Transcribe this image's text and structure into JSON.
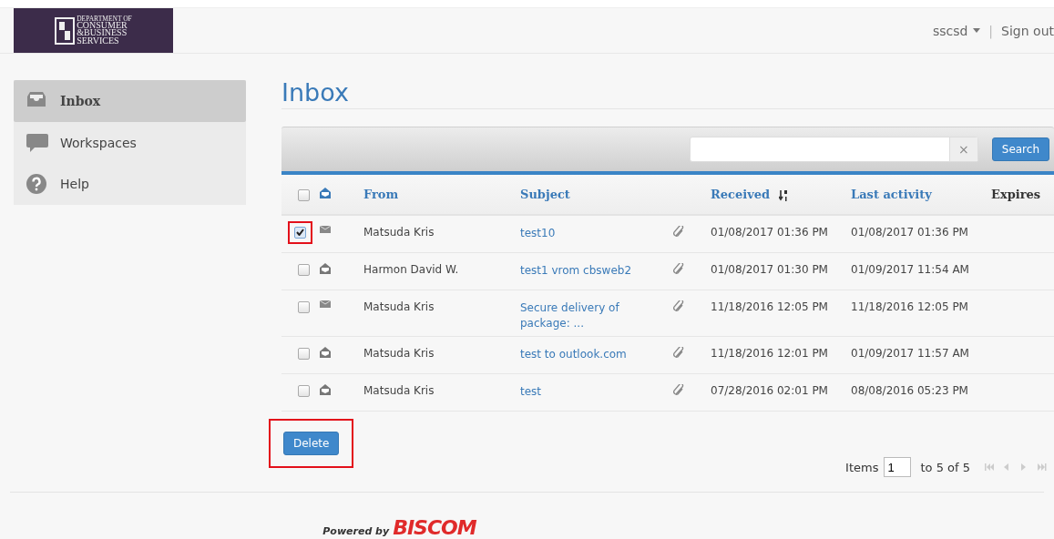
{
  "header": {
    "logo_lines": [
      "DEPARTMENT OF",
      "CONSUMER",
      "&BUSINESS",
      "SERVICES"
    ],
    "user": "sscsd",
    "separator": "|",
    "sign_out": "Sign out"
  },
  "sidebar": {
    "items": [
      {
        "label": "Inbox",
        "kind": "inbox",
        "selected": true
      },
      {
        "label": "Workspaces",
        "kind": "chat",
        "selected": false
      },
      {
        "label": "Help",
        "kind": "help",
        "selected": false
      }
    ]
  },
  "page_title": "Inbox",
  "search": {
    "button": "Search",
    "clear": "×"
  },
  "table": {
    "select_all": false,
    "columns": [
      "From",
      "Subject",
      "Received",
      "Last activity",
      "Expires"
    ],
    "rows": [
      {
        "checked": true,
        "highlighted": true,
        "read": false,
        "from": "Matsuda Kris",
        "subject": "test10",
        "attachment": true,
        "received": "01/08/2017 01:36 PM",
        "last_activity": "01/08/2017 01:36 PM"
      },
      {
        "checked": false,
        "highlighted": false,
        "read": true,
        "from": "Harmon David W.",
        "subject": "test1 vrom cbsweb2",
        "attachment": true,
        "received": "01/08/2017 01:30 PM",
        "last_activity": "01/09/2017 11:54 AM"
      },
      {
        "checked": false,
        "highlighted": false,
        "read": false,
        "from": "Matsuda Kris",
        "subject": "Secure delivery of package: ...",
        "attachment": true,
        "received": "11/18/2016 12:05 PM",
        "last_activity": "11/18/2016 12:05 PM"
      },
      {
        "checked": false,
        "highlighted": false,
        "read": true,
        "from": "Matsuda Kris",
        "subject": "test to outlook.com",
        "attachment": true,
        "received": "11/18/2016 12:01 PM",
        "last_activity": "01/09/2017 11:57 AM"
      },
      {
        "checked": false,
        "highlighted": false,
        "read": true,
        "from": "Matsuda Kris",
        "subject": "test",
        "attachment": true,
        "received": "07/28/2016 02:01 PM",
        "last_activity": "08/08/2016 05:23 PM"
      }
    ]
  },
  "delete_button": {
    "label": "Delete",
    "highlighted": true
  },
  "pager": {
    "label": "Items",
    "value": "1",
    "range": "to 5 of 5"
  },
  "footer": {
    "powered_by": "Powered by",
    "brand": "BISCOM"
  }
}
